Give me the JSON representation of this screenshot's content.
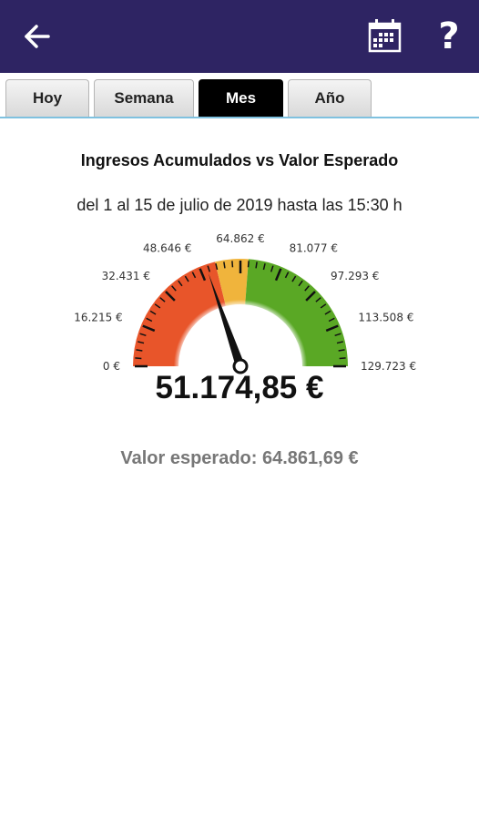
{
  "header": {
    "back_icon": "back-arrow-icon",
    "calendar_icon": "calendar-icon",
    "help_label": "?"
  },
  "tabs": [
    {
      "label": "Hoy",
      "active": false
    },
    {
      "label": "Semana",
      "active": false
    },
    {
      "label": "Mes",
      "active": true
    },
    {
      "label": "Año",
      "active": false
    }
  ],
  "report": {
    "title": "Ingresos Acumulados vs Valor Esperado",
    "period": "del 1 al 15 de julio de 2019 hasta las 15:30 h",
    "current_value_label": "51.174,85 €",
    "expected_label": "Valor esperado: 64.861,69 €"
  },
  "gauge": {
    "min": 0,
    "max": 129723,
    "value": 51174.85,
    "expected": 64861.69,
    "tick_labels": [
      "0 €",
      "16.215 €",
      "32.431 €",
      "48.646 €",
      "64.862 €",
      "81.077 €",
      "97.293 €",
      "113.508 €",
      "129.723 €"
    ],
    "bands": [
      {
        "from": 0,
        "to": 55000,
        "color": "#e8552a"
      },
      {
        "from": 55000,
        "to": 68000,
        "color": "#f0b43c"
      },
      {
        "from": 68000,
        "to": 129723,
        "color": "#5aa825"
      }
    ]
  }
}
